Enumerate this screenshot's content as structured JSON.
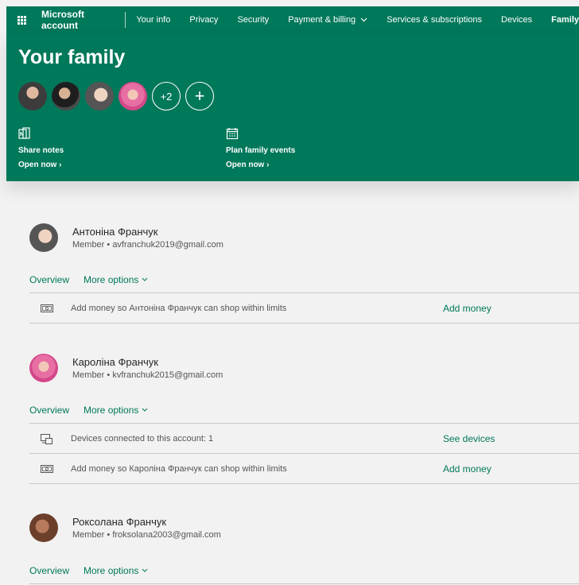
{
  "nav": {
    "brand": "Microsoft account",
    "links": [
      "Your info",
      "Privacy",
      "Security",
      "Payment & billing",
      "Services & subscriptions",
      "Devices",
      "Family"
    ],
    "active": "Family"
  },
  "hero": {
    "title": "Your family",
    "more_count": "+2",
    "add_symbol": "+",
    "tiles": [
      {
        "label": "Share notes",
        "link": "Open now ›"
      },
      {
        "label": "Plan family events",
        "link": "Open now ›"
      }
    ]
  },
  "members": [
    {
      "name": "Антоніна Франчук",
      "role": "Member",
      "email": "avfranchuk2019@gmail.com",
      "tabs": {
        "overview": "Overview",
        "more": "More options"
      },
      "rows": [
        {
          "icon": "money-icon",
          "text": "Add money so Антоніна Франчук can shop within limits",
          "action": "Add money"
        }
      ]
    },
    {
      "name": "Кароліна Франчук",
      "role": "Member",
      "email": "kvfranchuk2015@gmail.com",
      "tabs": {
        "overview": "Overview",
        "more": "More options"
      },
      "rows": [
        {
          "icon": "devices-icon",
          "text": "Devices connected to this account: 1",
          "action": "See devices"
        },
        {
          "icon": "money-icon",
          "text": "Add money so Кароліна Франчук can shop within limits",
          "action": "Add money"
        }
      ]
    },
    {
      "name": "Роксолана Франчук",
      "role": "Member",
      "email": "froksolana2003@gmail.com",
      "tabs": {
        "overview": "Overview",
        "more": "More options"
      }
    }
  ],
  "colors": {
    "brand_green": "#00785a",
    "page_bg": "#f2f2f2"
  }
}
